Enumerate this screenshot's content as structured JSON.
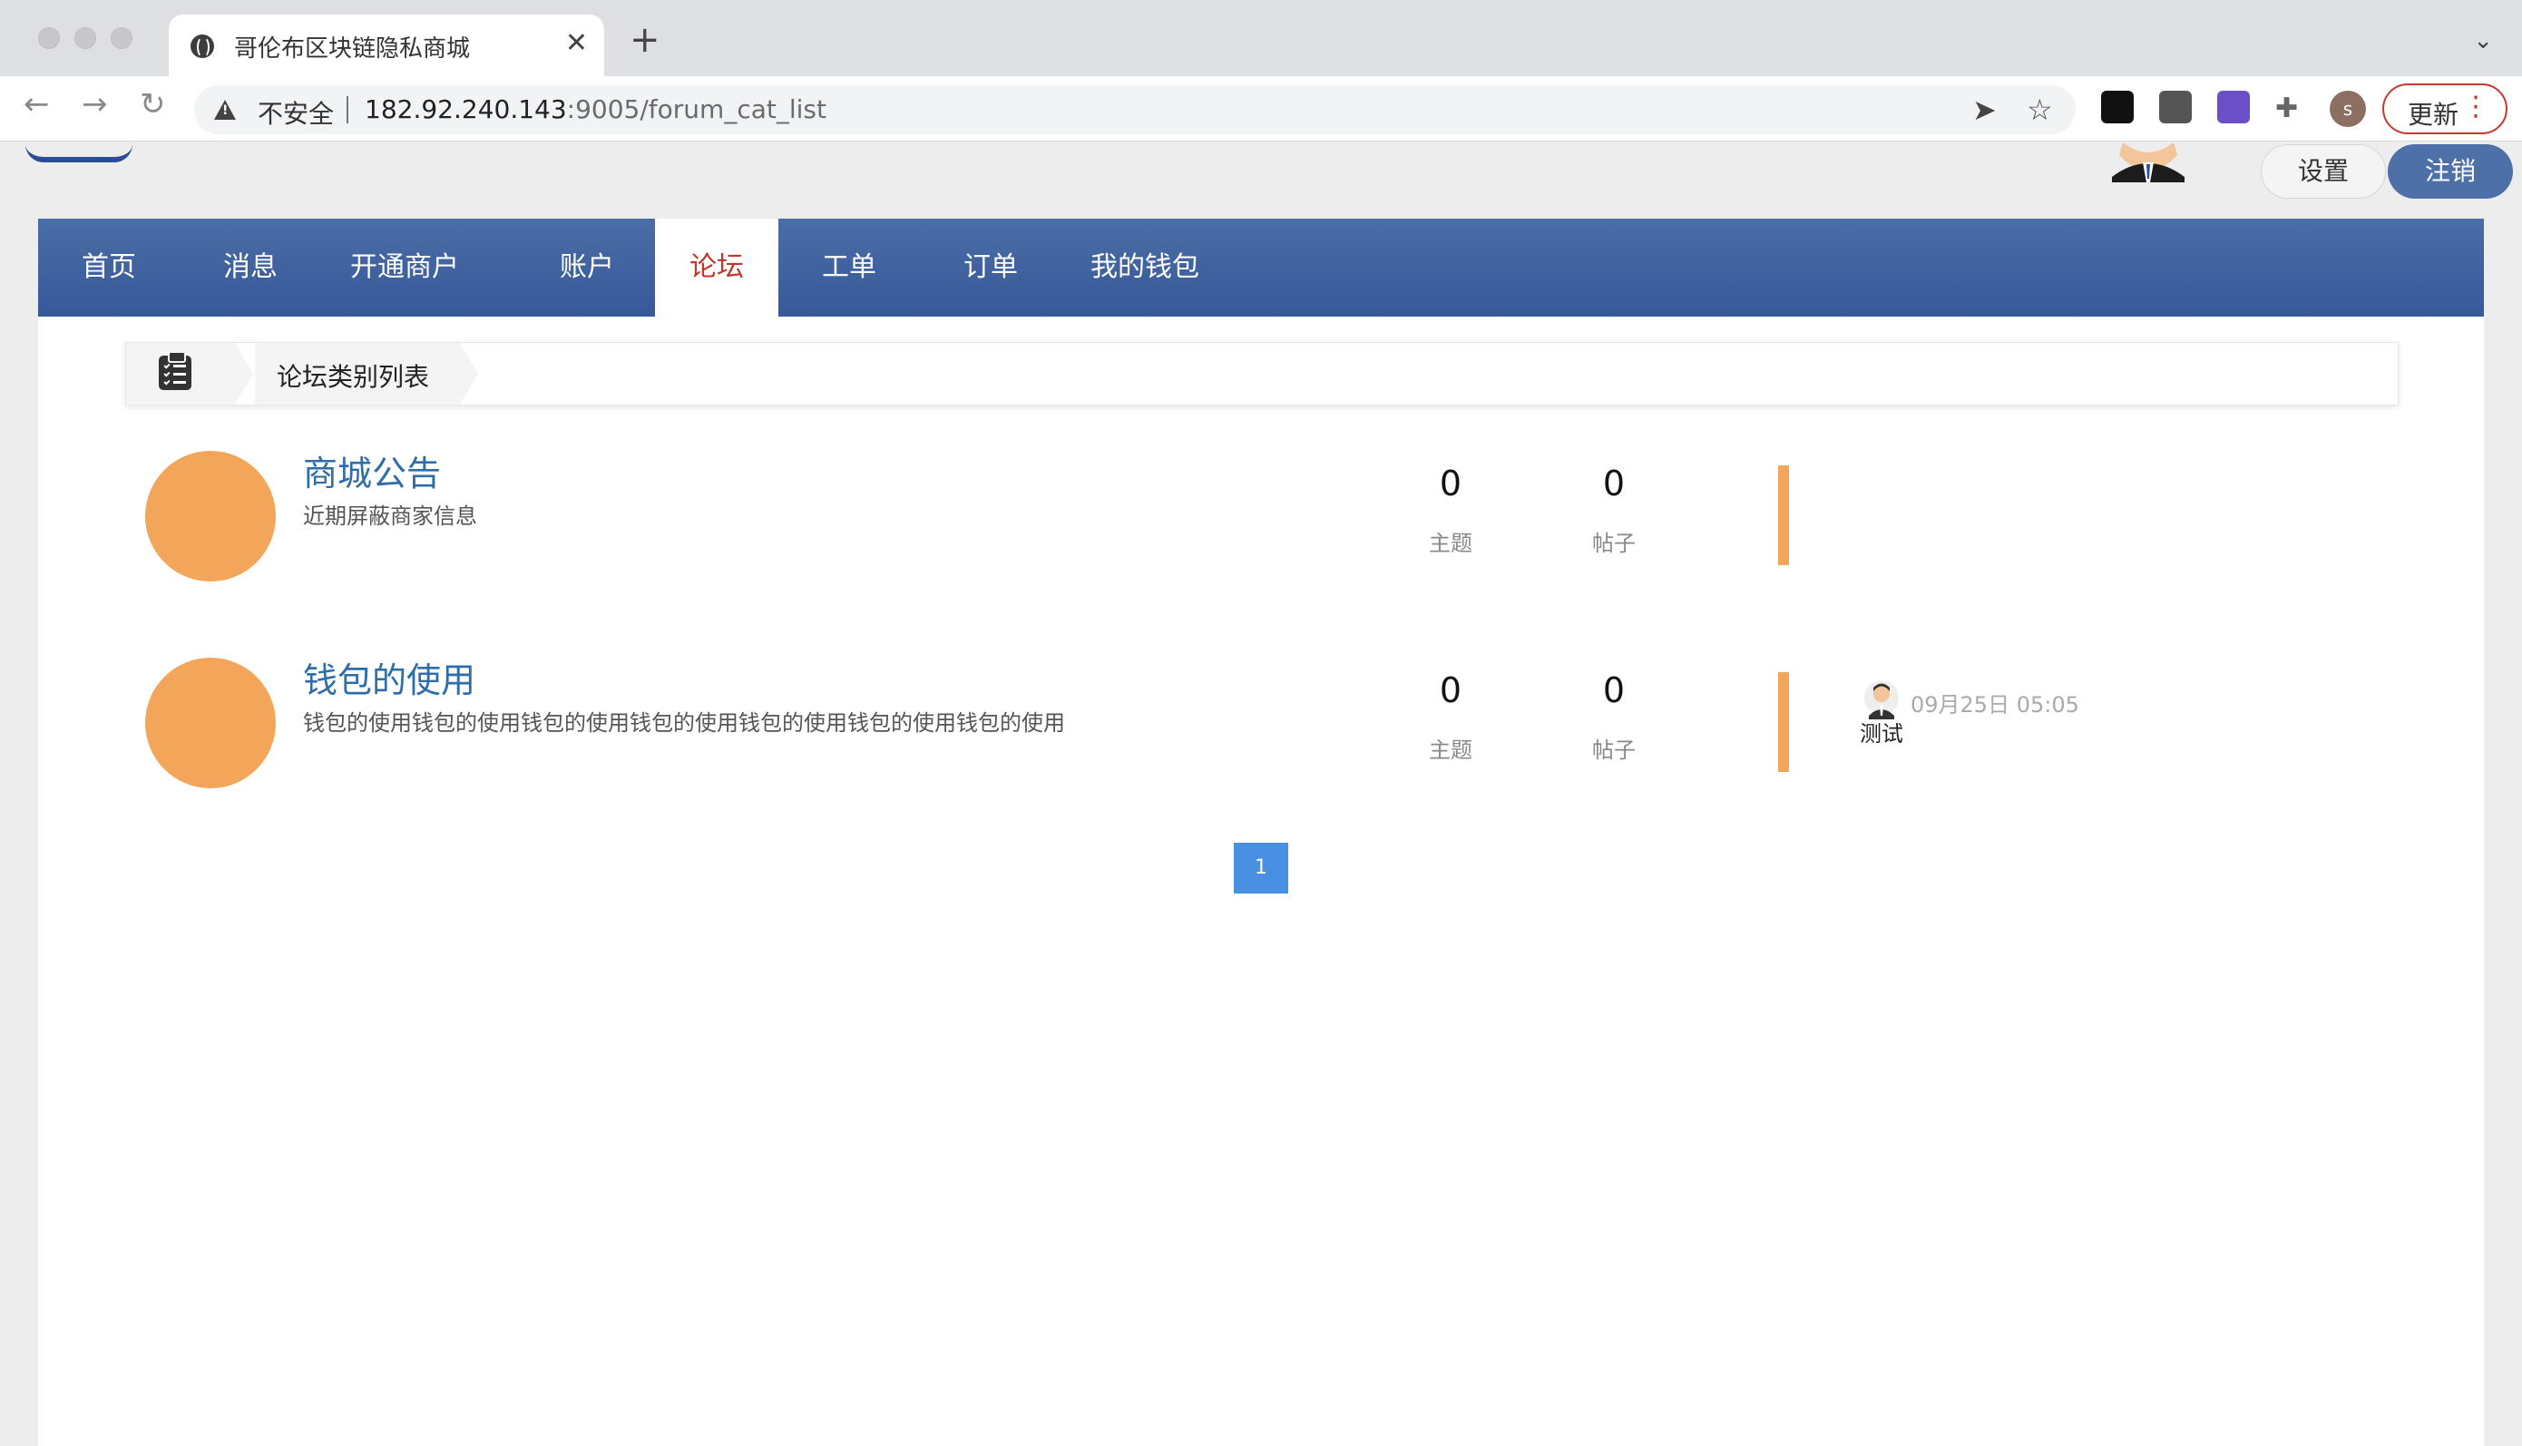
{
  "browser": {
    "tab_title": "哥伦布区块链隐私商城",
    "security_label": "不安全",
    "url_host": "182.92.240.143",
    "url_rest": ":9005/forum_cat_list",
    "update_label": "更新",
    "profile_initial": "s"
  },
  "header": {
    "settings_label": "设置",
    "logout_label": "注销"
  },
  "nav": {
    "items": [
      {
        "label": "首页"
      },
      {
        "label": "消息"
      },
      {
        "label": "开通商户"
      },
      {
        "label": "账户"
      },
      {
        "label": "论坛"
      },
      {
        "label": "工单"
      },
      {
        "label": "订单"
      },
      {
        "label": "我的钱包"
      }
    ],
    "active": "论坛"
  },
  "breadcrumb": {
    "label": "论坛类别列表"
  },
  "categories": [
    {
      "title": "商城公告",
      "description": "近期屏蔽商家信息",
      "topics": "0",
      "topics_label": "主题",
      "posts": "0",
      "posts_label": "帖子",
      "last_time": "",
      "last_user": ""
    },
    {
      "title": "钱包的使用",
      "description": "钱包的使用钱包的使用钱包的使用钱包的使用钱包的使用钱包的使用钱包的使用",
      "topics": "0",
      "topics_label": "主题",
      "posts": "0",
      "posts_label": "帖子",
      "last_time": "09月25日 05:05",
      "last_user": "测试"
    }
  ],
  "pagination": {
    "current": "1"
  },
  "colors": {
    "nav_bg": "#3f62a0",
    "accent_orange": "#f3a65a",
    "active_tab_text": "#c1372f",
    "title_blue": "#2f6da8",
    "page_button": "#4a90e2"
  }
}
